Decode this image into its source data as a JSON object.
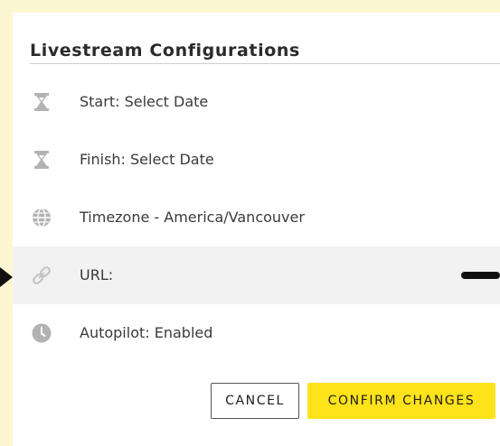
{
  "panel": {
    "title": "Livestream Configurations"
  },
  "config": {
    "rows": [
      {
        "icon": "hourglass-icon",
        "label": "Start: Select Date"
      },
      {
        "icon": "hourglass-icon",
        "label": "Finish: Select Date"
      },
      {
        "icon": "globe-icon",
        "label": "Timezone - America/Vancouver"
      },
      {
        "icon": "link-icon",
        "label": "URL:"
      },
      {
        "icon": "clock-icon",
        "label": "Autopilot: Enabled"
      }
    ]
  },
  "actions": {
    "cancel_label": "CANCEL",
    "confirm_label": "CONFIRM CHANGES"
  },
  "colors": {
    "page_background": "#fdf6d3",
    "panel_background": "#ffffff",
    "highlight_row": "#f2f2f2",
    "icon_gray": "#b3b3b3",
    "confirm_yellow": "#ffe31a"
  }
}
